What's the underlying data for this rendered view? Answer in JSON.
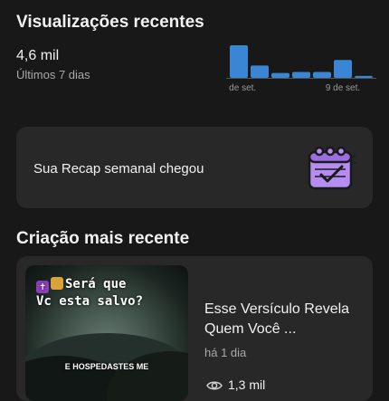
{
  "views": {
    "title": "Visualizações recentes",
    "value": "4,6 mil",
    "period": "Últimos 7 dias"
  },
  "chart_data": {
    "type": "bar",
    "categories": [
      "3 de set.",
      "",
      "",
      "",
      "",
      "9 de set.",
      ""
    ],
    "values": [
      100,
      38,
      15,
      18,
      18,
      55,
      6
    ],
    "tick_labels": [
      "3 de set.",
      "9 de set."
    ],
    "title": "",
    "xlabel": "",
    "ylabel": "",
    "bar_color": "#3a86d4",
    "grid": false
  },
  "recap": {
    "label": "Sua Recap semanal chegou",
    "icon": "calendar-check-icon",
    "icon_color": "#b58cf0"
  },
  "creation": {
    "title": "Criação mais recente",
    "thumbnail": {
      "line1": "Será que",
      "line2": "Vc esta salvo?",
      "caption": "E HOSPEDASTES ME"
    },
    "video_title": "Esse Versículo Revela Quem Você ...",
    "age": "há 1 dia",
    "views": "1,3 mil",
    "views_icon": "eye-icon"
  }
}
